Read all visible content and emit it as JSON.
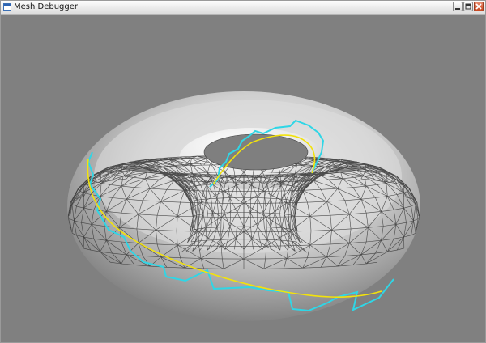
{
  "window": {
    "title": "Mesh Debugger",
    "icon": "app-window-icon",
    "controls": [
      "minimize-icon",
      "maximize-icon",
      "close-icon"
    ]
  },
  "viewport": {
    "background": "#808080",
    "mesh": "torus",
    "mesh_fill": "#d9d9d9",
    "wire_color": "#333333",
    "paths": [
      {
        "name": "staircase-path",
        "color": "#2fd6e6"
      },
      {
        "name": "smooth-path",
        "color": "#f2e20c"
      }
    ]
  }
}
